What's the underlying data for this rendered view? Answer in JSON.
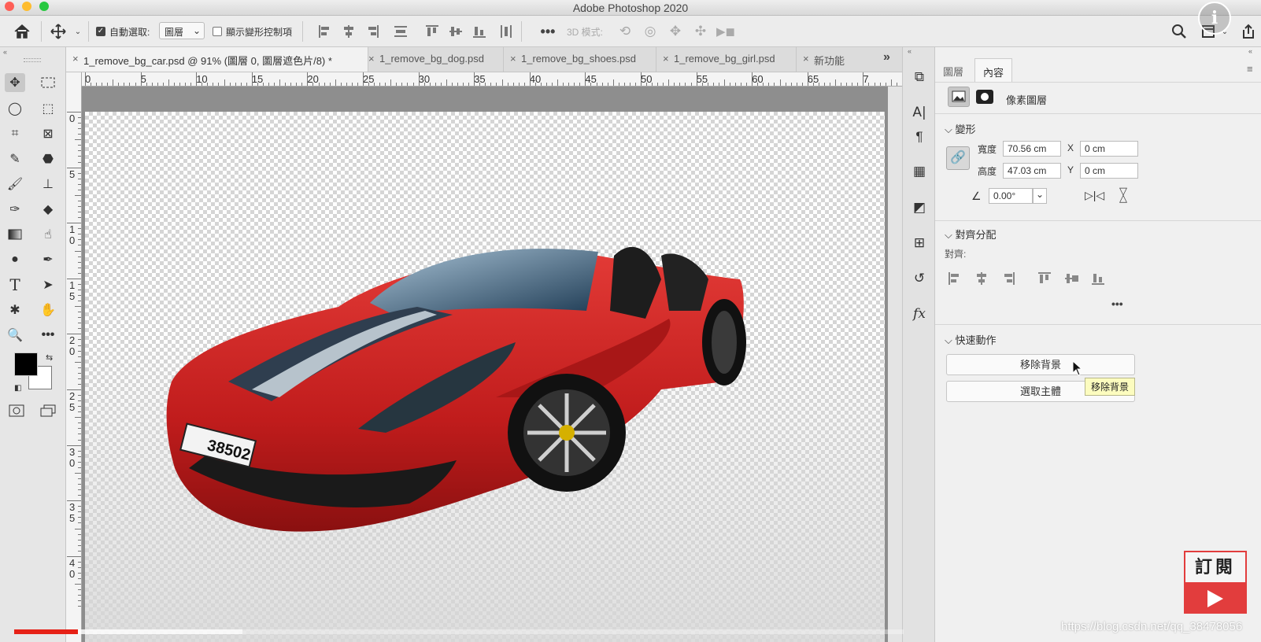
{
  "app": {
    "title": "Adobe Photoshop 2020"
  },
  "options": {
    "auto_select_label": "自動選取:",
    "auto_select_checked": true,
    "layer_select_value": "圖層",
    "show_transform_label": "顯示變形控制項",
    "mode_3d_label": "3D 模式:"
  },
  "tabs": [
    {
      "label": "1_remove_bg_car.psd @ 91% (圖層 0, 圖層遮色片/8) *",
      "active": true
    },
    {
      "label": "1_remove_bg_dog.psd",
      "active": false
    },
    {
      "label": "1_remove_bg_shoes.psd",
      "active": false
    },
    {
      "label": "1_remove_bg_girl.psd",
      "active": false
    },
    {
      "label": "新功能",
      "active": false
    }
  ],
  "ruler": {
    "h": [
      "0",
      "5",
      "10",
      "15",
      "20",
      "25",
      "30",
      "35",
      "40",
      "45",
      "50",
      "55",
      "60",
      "65",
      "7"
    ],
    "v": [
      [
        "0"
      ],
      [
        "5"
      ],
      [
        "1",
        "0"
      ],
      [
        "1",
        "5"
      ],
      [
        "2",
        "0"
      ],
      [
        "2",
        "5"
      ],
      [
        "3",
        "0"
      ],
      [
        "3",
        "5"
      ],
      [
        "4",
        "0"
      ]
    ]
  },
  "panel": {
    "tabs": [
      "圖層",
      "內容"
    ],
    "layer_type": "像素圖層",
    "transform": {
      "heading": "變形",
      "width_label": "寬度",
      "width_value": "70.56 cm",
      "height_label": "高度",
      "height_value": "47.03 cm",
      "x_label": "X",
      "x_value": "0 cm",
      "y_label": "Y",
      "y_value": "0 cm",
      "angle_value": "0.00°"
    },
    "align": {
      "heading": "對齊分配",
      "sub": "對齊:"
    },
    "quick": {
      "heading": "快速動作",
      "remove_bg": "移除背景",
      "select_subject": "選取主體",
      "tooltip": "移除背景"
    }
  },
  "overlay": {
    "subscribe": "訂閱",
    "watermark": "https://blog.csdn.net/qq_38478056",
    "video_progress": 0.072
  },
  "colors": {
    "car": "#c8201f",
    "subscribe": "#e23d3d",
    "progress": "#e62117"
  }
}
